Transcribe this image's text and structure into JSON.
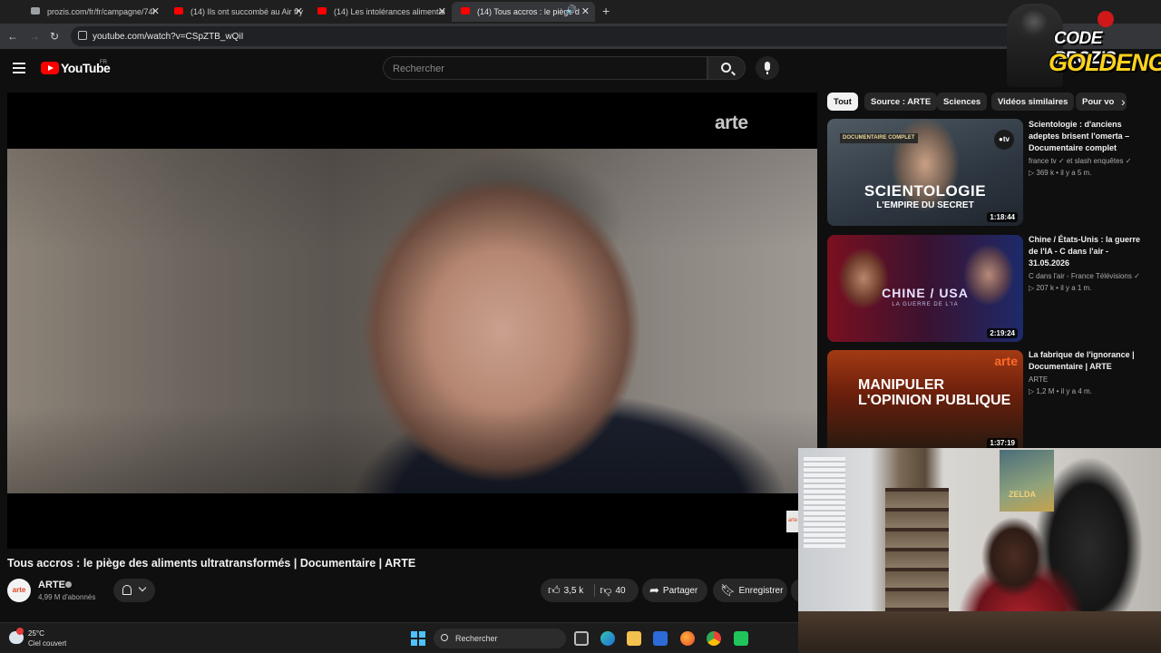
{
  "browser": {
    "tabs": [
      {
        "label": "prozis.com/fr/fr/campagne/74l",
        "active": false
      },
      {
        "label": "(14) Ils ont succombé au Air fry",
        "active": false
      },
      {
        "label": "(14) Les intolérances alimentai",
        "active": false
      },
      {
        "label": "(14) Tous accros : le piège d",
        "active": true
      }
    ],
    "new_tab": "+",
    "url": "youtube.com/watch?v=CSpZTB_wQiI"
  },
  "youtube": {
    "logo_text": "YouTube",
    "country": "FR",
    "search_placeholder": "Rechercher"
  },
  "video": {
    "watermark": "arte",
    "corner_logo": "arte",
    "title": "Tous accros : le piège des aliments ultratransformés | Documentaire | ARTE",
    "channel": "ARTE",
    "avatar_text": "arte",
    "subscribers": "4,99 M d'abonnés",
    "likes": "3,5 k",
    "dislikes": "40",
    "share_label": "Partager",
    "save_label": "Enregistrer"
  },
  "chips": [
    "Tout",
    "Source : ARTE",
    "Sciences",
    "Vidéos similaires",
    "Pour vo"
  ],
  "recommendations": [
    {
      "title": "Scientologie : d'anciens adeptes brisent l'omerta – Documentaire complet",
      "channel": "france tv ✓ et slash enquêtes ✓",
      "views": "369 k",
      "age": "il y a 5 m.",
      "duration": "1:18:44",
      "thumb_text": "SCIENTOLOGIE",
      "thumb_sub": "L'EMPIRE DU SECRET",
      "thumb_badge": "DOCUMENTAIRE COMPLET",
      "thumb_logo": "●tv"
    },
    {
      "title": "Chine / États-Unis : la guerre de l'IA  -  C dans l'air - 31.05.2026",
      "channel": "C dans l'air - France Télévisions ✓",
      "views": "207 k",
      "age": "il y a 1 m.",
      "duration": "2:19:24",
      "thumb_text": "CHINE / USA",
      "thumb_sub": "LA GUERRE DE L'IA"
    },
    {
      "title": "La fabrique de l'ignorance | Documentaire | ARTE",
      "channel": "ARTE",
      "views": "1,2 M",
      "age": "il y a 4 m.",
      "duration": "1:37:19",
      "thumb_text": "MANIPULER L'OPINION PUBLIQUE",
      "thumb_logo": "arte"
    }
  ],
  "overlay": {
    "logo_line1": "CODE PROZIS",
    "logo_line2": "GOLDENG",
    "poster_text": "ZELDA"
  },
  "taskbar": {
    "temperature": "25°C",
    "condition": "Ciel couvert",
    "search_label": "Rechercher"
  },
  "colors": {
    "youtube_red": "#ff0000",
    "background": "#0f0f0f",
    "chip_active": "#f1f1f1",
    "logo_yellow": "#ffd21e",
    "windows_blue": "#4cc2ff"
  }
}
